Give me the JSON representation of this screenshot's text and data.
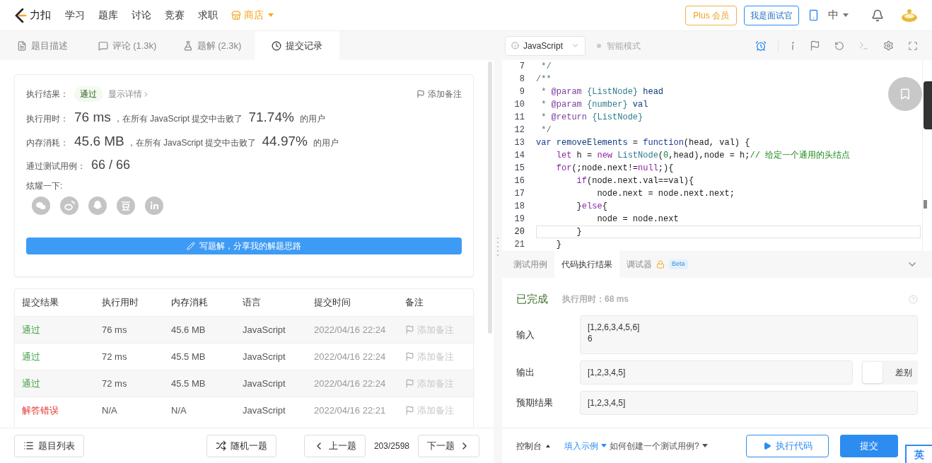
{
  "nav": {
    "logo": "力扣",
    "items": [
      "学习",
      "题库",
      "讨论",
      "竞赛",
      "求职"
    ],
    "store": "商店",
    "plus": "Plus 会员",
    "interviewer": "我是面试官",
    "lang": "中"
  },
  "tabs": [
    {
      "label": "题目描述",
      "kind": "description",
      "selected": false
    },
    {
      "label": "评论 (1.3k)",
      "kind": "comment",
      "selected": false
    },
    {
      "label": "题解 (2.3k)",
      "kind": "solution",
      "selected": false
    },
    {
      "label": "提交记录",
      "kind": "history",
      "selected": true
    }
  ],
  "result": {
    "label": "执行结果：",
    "status": "通过",
    "details": "显示详情",
    "add_note": "添加备注",
    "stats": [
      {
        "label": "执行用时：",
        "value": "76 ms",
        "mid": "，在所有 JavaScript 提交中击败了",
        "pct": "71.74%",
        "tail": "的用户"
      },
      {
        "label": "内存消耗：",
        "value": "45.6 MB",
        "mid": "，在所有 JavaScript 提交中击败了",
        "pct": "44.97%",
        "tail": "的用户"
      }
    ],
    "cases_label": "通过测试用例：",
    "cases": "66 / 66",
    "share_label": "炫耀一下:",
    "write_button": "写题解，分享我的解题思路"
  },
  "table": {
    "columns": [
      "提交结果",
      "执行用时",
      "内存消耗",
      "语言",
      "提交时间",
      "备注"
    ],
    "rows": [
      {
        "result": "通过",
        "kind": "accepted",
        "time": "76 ms",
        "memory": "45.6 MB",
        "language": "JavaScript",
        "submitted": "2022/04/16 22:24",
        "note": "添加备注"
      },
      {
        "result": "通过",
        "kind": "accepted",
        "time": "72 ms",
        "memory": "45.5 MB",
        "language": "JavaScript",
        "submitted": "2022/04/16 22:24",
        "note": "添加备注"
      },
      {
        "result": "通过",
        "kind": "accepted",
        "time": "72 ms",
        "memory": "45.5 MB",
        "language": "JavaScript",
        "submitted": "2022/04/16 22:24",
        "note": "添加备注"
      },
      {
        "result": "解答错误",
        "kind": "wrong",
        "time": "N/A",
        "memory": "N/A",
        "language": "JavaScript",
        "submitted": "2022/04/16 22:21",
        "note": "添加备注"
      }
    ]
  },
  "bottom_left": {
    "list": "题目列表",
    "random": "随机一题",
    "prev": "上一题",
    "page": "203/2598",
    "next": "下一题"
  },
  "editor": {
    "language": "JavaScript",
    "mode": "智能模式",
    "lines": [
      {
        "no": "7",
        "current": false,
        "tokens": [
          {
            "t": " */",
            "kind": "doc"
          }
        ]
      },
      {
        "no": "8",
        "current": false,
        "tokens": [
          {
            "t": "/**",
            "kind": "doc"
          }
        ]
      },
      {
        "no": "9",
        "current": false,
        "tokens": [
          {
            "t": " * ",
            "kind": "doc"
          },
          {
            "t": "@param",
            "kind": "tag"
          },
          {
            "t": " {ListNode}",
            "kind": "type"
          },
          {
            "t": " head",
            "kind": "def"
          }
        ]
      },
      {
        "no": "10",
        "current": false,
        "tokens": [
          {
            "t": " * ",
            "kind": "doc"
          },
          {
            "t": "@param",
            "kind": "tag"
          },
          {
            "t": " {number}",
            "kind": "type"
          },
          {
            "t": " val",
            "kind": "def"
          }
        ]
      },
      {
        "no": "11",
        "current": false,
        "tokens": [
          {
            "t": " * ",
            "kind": "doc"
          },
          {
            "t": "@return",
            "kind": "tag"
          },
          {
            "t": " {ListNode}",
            "kind": "type"
          }
        ]
      },
      {
        "no": "12",
        "current": false,
        "tokens": [
          {
            "t": " */",
            "kind": "doc"
          }
        ]
      },
      {
        "no": "13",
        "current": false,
        "tokens": [
          {
            "t": "var",
            "kind": "decl"
          },
          {
            "t": " removeElements",
            "kind": "def"
          },
          {
            "t": " = ",
            "kind": "plain"
          },
          {
            "t": "function",
            "kind": "decl"
          },
          {
            "t": "(head, val) {",
            "kind": "plain"
          }
        ]
      },
      {
        "no": "14",
        "current": false,
        "tokens": [
          {
            "t": "    let",
            "kind": "kw"
          },
          {
            "t": " h = ",
            "kind": "plain"
          },
          {
            "t": "new",
            "kind": "kw"
          },
          {
            "t": " ListNode",
            "kind": "type"
          },
          {
            "t": "(",
            "kind": "plain"
          },
          {
            "t": "0",
            "kind": "num"
          },
          {
            "t": ",head),node = h;",
            "kind": "plain"
          },
          {
            "t": "// 给定一个通用的头结点",
            "kind": "cm"
          }
        ]
      },
      {
        "no": "15",
        "current": false,
        "tokens": [
          {
            "t": "    for",
            "kind": "kw"
          },
          {
            "t": "(;node.next!=",
            "kind": "plain"
          },
          {
            "t": "null",
            "kind": "kw"
          },
          {
            "t": ";){",
            "kind": "plain"
          }
        ]
      },
      {
        "no": "16",
        "current": false,
        "tokens": [
          {
            "t": "        if",
            "kind": "kw"
          },
          {
            "t": "(node.next.val==val){",
            "kind": "plain"
          }
        ]
      },
      {
        "no": "17",
        "current": false,
        "tokens": [
          {
            "t": "            node.next = node.next.next;",
            "kind": "plain"
          }
        ]
      },
      {
        "no": "18",
        "current": false,
        "tokens": [
          {
            "t": "        }",
            "kind": "plain"
          },
          {
            "t": "else",
            "kind": "kw"
          },
          {
            "t": "{",
            "kind": "plain"
          }
        ]
      },
      {
        "no": "19",
        "current": false,
        "tokens": [
          {
            "t": "            node = node.next",
            "kind": "plain"
          }
        ]
      },
      {
        "no": "20",
        "current": true,
        "tokens": [
          {
            "t": "        }",
            "kind": "plain"
          }
        ]
      },
      {
        "no": "21",
        "current": false,
        "tokens": [
          {
            "t": "    }",
            "kind": "plain"
          }
        ]
      }
    ]
  },
  "console": {
    "tabs": [
      {
        "label": "测试用例",
        "selected": false,
        "locked": false
      },
      {
        "label": "代码执行结果",
        "selected": true,
        "locked": false
      },
      {
        "label": "调试器",
        "selected": false,
        "locked": true,
        "badge": "Beta"
      }
    ],
    "status": "已完成",
    "time": "执行用时：68 ms",
    "fields": [
      {
        "label": "输入",
        "lines": [
          "[1,2,6,3,4,5,6]",
          "6"
        ]
      },
      {
        "label": "输出",
        "lines": [
          "[1,2,3,4,5]"
        ],
        "diff": "差别"
      },
      {
        "label": "预期结果",
        "lines": [
          "[1,2,3,4,5]"
        ]
      }
    ]
  },
  "bottom_right": {
    "console": "控制台",
    "example": "填入示例",
    "howto": "如何创建一个测试用例?",
    "run": "执行代码",
    "submit": "提交",
    "ime": "英"
  }
}
